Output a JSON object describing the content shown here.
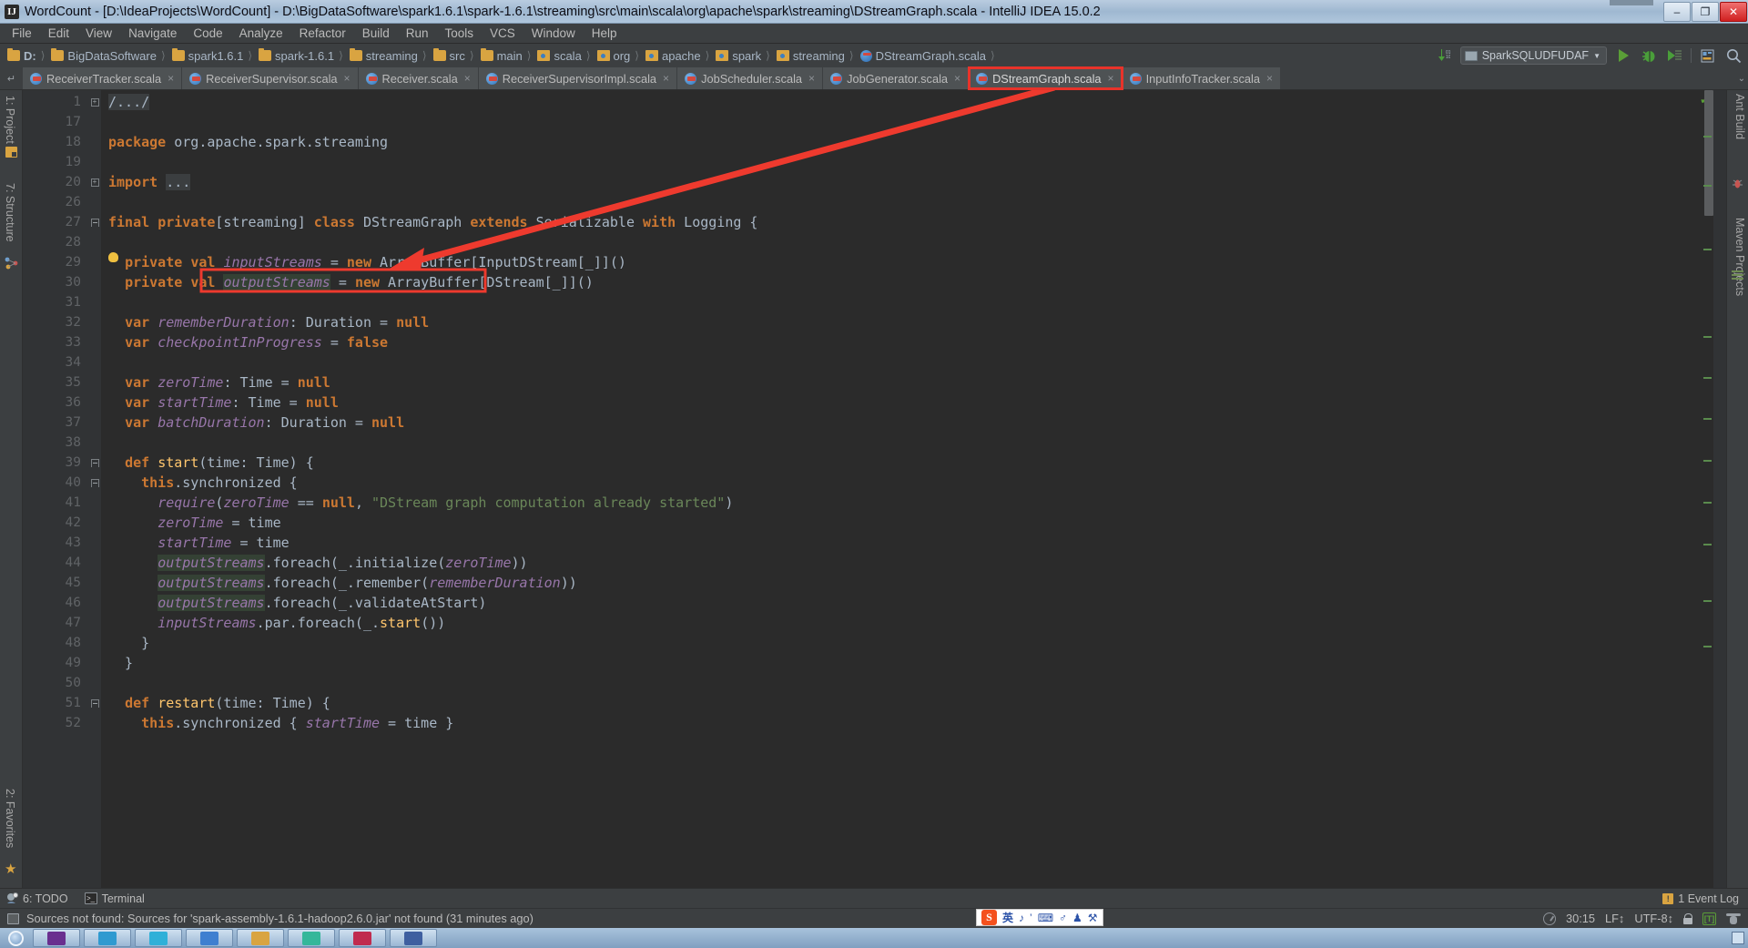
{
  "window": {
    "title": "WordCount - [D:\\IdeaProjects\\WordCount] - D:\\BigDataSoftware\\spark1.6.1\\spark-1.6.1\\streaming\\src\\main\\scala\\org\\apache\\spark\\streaming\\DStreamGraph.scala - IntelliJ IDEA 15.0.2",
    "app_icon": "IJ",
    "minimize": "–",
    "maximize": "❐",
    "close": "✕"
  },
  "menu": {
    "items": [
      "File",
      "Edit",
      "View",
      "Navigate",
      "Code",
      "Analyze",
      "Refactor",
      "Build",
      "Run",
      "Tools",
      "VCS",
      "Window",
      "Help"
    ]
  },
  "breadcrumb": {
    "items": [
      {
        "label": "D:",
        "icon": "folder-icon"
      },
      {
        "label": "BigDataSoftware",
        "icon": "folder-icon"
      },
      {
        "label": "spark1.6.1",
        "icon": "folder-icon"
      },
      {
        "label": "spark-1.6.1",
        "icon": "folder-icon"
      },
      {
        "label": "streaming",
        "icon": "folder-icon"
      },
      {
        "label": "src",
        "icon": "folder-icon"
      },
      {
        "label": "main",
        "icon": "folder-icon"
      },
      {
        "label": "scala",
        "icon": "source-folder-icon"
      },
      {
        "label": "org",
        "icon": "source-folder-icon"
      },
      {
        "label": "apache",
        "icon": "source-folder-icon"
      },
      {
        "label": "spark",
        "icon": "source-folder-icon"
      },
      {
        "label": "streaming",
        "icon": "source-folder-icon"
      },
      {
        "label": "DStreamGraph.scala",
        "icon": "scala-file-icon"
      }
    ]
  },
  "toolbar": {
    "run_config": "SparkSQLUDFUDAF",
    "run_title": "Run",
    "debug_title": "Debug",
    "coverage_title": "Run with Coverage",
    "search_title": "Search Everywhere",
    "layout_title": "Layout",
    "update_title": "Update Project"
  },
  "editor_tabs": [
    {
      "label": "ReceiverTracker.scala",
      "close": "×",
      "active": false,
      "highlighted": false
    },
    {
      "label": "ReceiverSupervisor.scala",
      "close": "×",
      "active": false,
      "highlighted": false
    },
    {
      "label": "Receiver.scala",
      "close": "×",
      "active": false,
      "highlighted": false
    },
    {
      "label": "ReceiverSupervisorImpl.scala",
      "close": "×",
      "active": false,
      "highlighted": false
    },
    {
      "label": "JobScheduler.scala",
      "close": "×",
      "active": false,
      "highlighted": false
    },
    {
      "label": "JobGenerator.scala",
      "close": "×",
      "active": false,
      "highlighted": false
    },
    {
      "label": "DStreamGraph.scala",
      "close": "×",
      "active": true,
      "highlighted": true
    },
    {
      "label": "InputInfoTracker.scala",
      "close": "×",
      "active": false,
      "highlighted": false
    }
  ],
  "left_tool_window": {
    "items": [
      "1: Project",
      "7: Structure",
      "2: Favorites"
    ]
  },
  "right_tool_window": {
    "items": [
      "Ant Build",
      "Maven Projects"
    ]
  },
  "editor": {
    "file": "DStreamGraph.scala",
    "line_numbers": [
      "1",
      "17",
      "18",
      "19",
      "20",
      "26",
      "27",
      "28",
      "29",
      "30",
      "31",
      "32",
      "33",
      "34",
      "35",
      "36",
      "37",
      "38",
      "39",
      "40",
      "41",
      "42",
      "43",
      "44",
      "45",
      "46",
      "47",
      "48",
      "49",
      "50",
      "51",
      "52"
    ],
    "lines": [
      {
        "n": "1",
        "fold": "plus",
        "text": "/.../",
        "kind": "folded-comment"
      },
      {
        "n": "17",
        "fold": "",
        "text": "",
        "kind": "blank"
      },
      {
        "n": "18",
        "fold": "",
        "text": "package org.apache.spark.streaming",
        "kind": "package"
      },
      {
        "n": "19",
        "fold": "",
        "text": "",
        "kind": "blank"
      },
      {
        "n": "20",
        "fold": "plus",
        "text": "import ...",
        "kind": "import-folded"
      },
      {
        "n": "26",
        "fold": "",
        "text": "",
        "kind": "blank"
      },
      {
        "n": "27",
        "fold": "minus",
        "text": "final private[streaming] class DStreamGraph extends Serializable with Logging {",
        "kind": "class-decl"
      },
      {
        "n": "28",
        "fold": "",
        "text": "",
        "kind": "blank"
      },
      {
        "n": "29",
        "fold": "",
        "text": "  private val inputStreams = new ArrayBuffer[InputDStream[_]]()",
        "kind": "val-decl",
        "bulb": true
      },
      {
        "n": "30",
        "fold": "",
        "text": "  private val outputStreams = new ArrayBuffer[DStream[_]]()",
        "kind": "val-decl",
        "boxed": true
      },
      {
        "n": "31",
        "fold": "",
        "text": "",
        "kind": "blank"
      },
      {
        "n": "32",
        "fold": "",
        "text": "  var rememberDuration: Duration = null",
        "kind": "var-decl"
      },
      {
        "n": "33",
        "fold": "",
        "text": "  var checkpointInProgress = false",
        "kind": "var-decl"
      },
      {
        "n": "34",
        "fold": "",
        "text": "",
        "kind": "blank"
      },
      {
        "n": "35",
        "fold": "",
        "text": "  var zeroTime: Time = null",
        "kind": "var-decl"
      },
      {
        "n": "36",
        "fold": "",
        "text": "  var startTime: Time = null",
        "kind": "var-decl"
      },
      {
        "n": "37",
        "fold": "",
        "text": "  var batchDuration: Duration = null",
        "kind": "var-decl"
      },
      {
        "n": "38",
        "fold": "",
        "text": "",
        "kind": "blank"
      },
      {
        "n": "39",
        "fold": "minus",
        "text": "  def start(time: Time) {",
        "kind": "def"
      },
      {
        "n": "40",
        "fold": "minus",
        "text": "    this.synchronized {",
        "kind": "block"
      },
      {
        "n": "41",
        "fold": "",
        "text": "      require(zeroTime == null, \"DStream graph computation already started\")",
        "kind": "stmt"
      },
      {
        "n": "42",
        "fold": "",
        "text": "      zeroTime = time",
        "kind": "stmt"
      },
      {
        "n": "43",
        "fold": "",
        "text": "      startTime = time",
        "kind": "stmt"
      },
      {
        "n": "44",
        "fold": "",
        "text": "      outputStreams.foreach(_.initialize(zeroTime))",
        "kind": "stmt"
      },
      {
        "n": "45",
        "fold": "",
        "text": "      outputStreams.foreach(_.remember(rememberDuration))",
        "kind": "stmt"
      },
      {
        "n": "46",
        "fold": "",
        "text": "      outputStreams.foreach(_.validateAtStart)",
        "kind": "stmt"
      },
      {
        "n": "47",
        "fold": "",
        "text": "      inputStreams.par.foreach(_.start())",
        "kind": "stmt"
      },
      {
        "n": "48",
        "fold": "",
        "text": "    }",
        "kind": "stmt"
      },
      {
        "n": "49",
        "fold": "",
        "text": "  }",
        "kind": "stmt"
      },
      {
        "n": "50",
        "fold": "",
        "text": "",
        "kind": "blank"
      },
      {
        "n": "51",
        "fold": "minus",
        "text": "  def restart(time: Time) {",
        "kind": "def"
      },
      {
        "n": "52",
        "fold": "",
        "text": "    this.synchronized { startTime = time }",
        "kind": "stmt"
      }
    ],
    "annotation": {
      "highlight_box_text": "outputStreams = new ArrayBuffer",
      "arrow_color": "#ee3a2e",
      "box_color": "#ee3a2e"
    }
  },
  "bottom_tool_bar": {
    "todo": "6: TODO",
    "terminal": "Terminal",
    "event_log": "1 Event Log"
  },
  "status_bar": {
    "message": "Sources not found: Sources for 'spark-assembly-1.6.1-hadoop2.6.0.jar' not found (31 minutes ago)",
    "caret_position": "30:15",
    "line_separator": "LF↕",
    "encoding": "UTF-8↕",
    "lock": "lock-icon",
    "ime_mode": "[T]",
    "inspection": "hector-icon"
  },
  "ime_panel": {
    "logo": "S",
    "mode": "英",
    "glyphs": [
      "♪",
      "’",
      "⌨",
      "♂",
      "♟",
      "⚒"
    ]
  },
  "taskbar": {
    "start": "start-orb",
    "apps": [
      "app-1",
      "app-2",
      "app-3",
      "app-4",
      "app-5",
      "app-6",
      "app-7",
      "app-8"
    ]
  },
  "colors": {
    "accent_red": "#ee3a2e",
    "editor_bg": "#2b2b2b",
    "gutter_bg": "#313335",
    "chrome_bg": "#3c3f41",
    "keyword": "#cc7832",
    "field": "#9876aa",
    "string": "#6a8759",
    "method": "#ffc66d",
    "text": "#a9b7c6"
  }
}
